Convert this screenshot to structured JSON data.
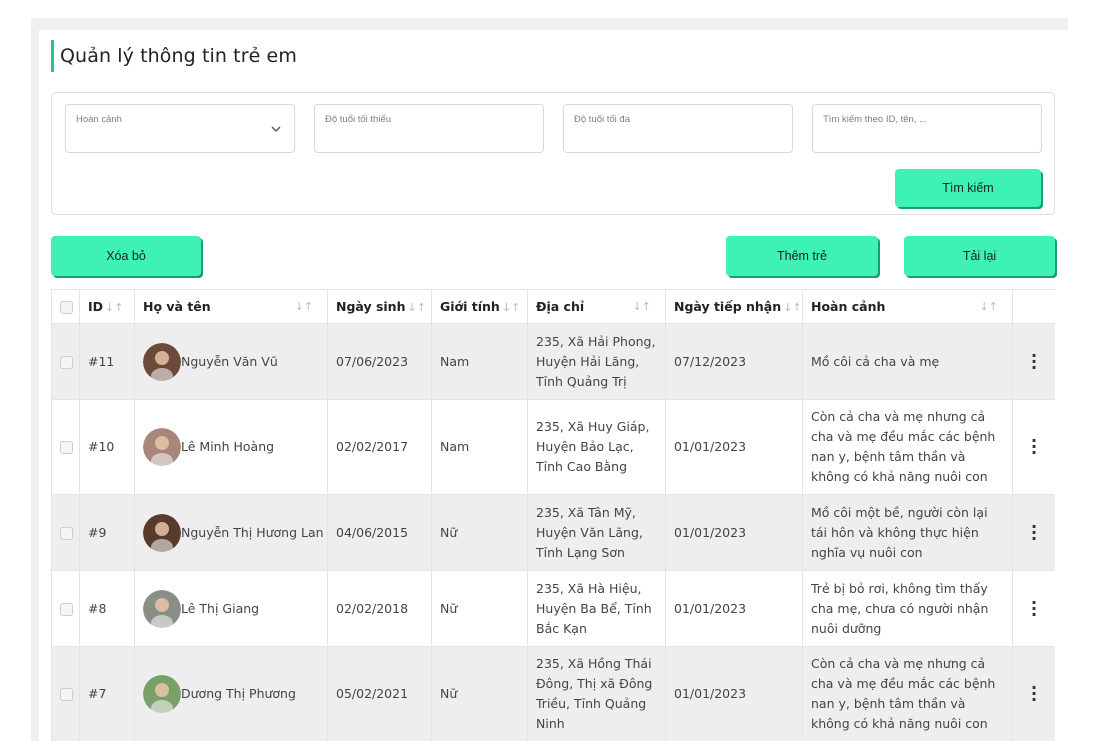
{
  "page": {
    "title": "Quản lý thông tin trẻ em",
    "accent_color": "#21c58e",
    "button_color": "#3df2b4"
  },
  "filters": {
    "circumstance_placeholder": "Hoàn cảnh",
    "min_age_placeholder": "Độ tuổi tối thiểu",
    "max_age_placeholder": "Độ tuổi tối đa",
    "search_placeholder": "Tìm kiếm theo ID, tên, ...",
    "search_button": "Tìm kiếm"
  },
  "toolbar": {
    "delete_label": "Xóa bỏ",
    "add_label": "Thêm trẻ",
    "reload_label": "Tải lại"
  },
  "table": {
    "headers": {
      "id": "ID",
      "name": "Họ và tên",
      "dob": "Ngày sinh",
      "gender": "Giới tính",
      "address": "Địa chỉ",
      "received": "Ngày tiếp nhận",
      "circumstance": "Hoàn cảnh",
      "sort_icon": "↓↑"
    },
    "rows": [
      {
        "id": "#11",
        "name": "Nguyễn Văn Vũ",
        "dob": "07/06/2023",
        "gender": "Nam",
        "address": "235, Xã Hải Phong, Huyện Hải Lăng, Tỉnh Quảng Trị",
        "received": "07/12/2023",
        "circumstance": "Mồ côi cả cha và mẹ",
        "avatar_color": "#6b4a3a"
      },
      {
        "id": "#10",
        "name": "Lê Minh Hoàng",
        "dob": "02/02/2017",
        "gender": "Nam",
        "address": "235, Xã Huy Giáp, Huyện Bảo Lạc, Tỉnh Cao Bằng",
        "received": "01/01/2023",
        "circumstance": "Còn cả cha và mẹ nhưng cả cha và mẹ đều mắc các bệnh nan y, bệnh tâm thần và không có khả năng nuôi con",
        "avatar_color": "#a8877a"
      },
      {
        "id": "#9",
        "name": "Nguyễn Thị Hương Lan",
        "dob": "04/06/2015",
        "gender": "Nữ",
        "address": "235, Xã Tân Mỹ, Huyện Văn Lãng, Tỉnh Lạng Sơn",
        "received": "01/01/2023",
        "circumstance": "Mồ côi một bề, người còn lại tái hôn và không thực hiện nghĩa vụ nuôi con",
        "avatar_color": "#5b3a2e"
      },
      {
        "id": "#8",
        "name": "Lê Thị Giang",
        "dob": "02/02/2018",
        "gender": "Nữ",
        "address": "235, Xã Hà Hiệu, Huyện Ba Bể, Tỉnh Bắc Kạn",
        "received": "01/01/2023",
        "circumstance": "Trẻ bị bỏ rơi, không tìm thấy cha mẹ, chưa có người nhận nuôi dưỡng",
        "avatar_color": "#8a8f86"
      },
      {
        "id": "#7",
        "name": "Dương Thị Phương",
        "dob": "05/02/2021",
        "gender": "Nữ",
        "address": "235, Xã Hồng Thái Đông, Thị xã Đông Triều, Tỉnh Quảng Ninh",
        "received": "01/01/2023",
        "circumstance": "Còn cả cha và mẹ nhưng cả cha và mẹ đều mắc các bệnh nan y, bệnh tâm thần và không có khả năng nuôi con",
        "avatar_color": "#7aa06a"
      }
    ]
  }
}
